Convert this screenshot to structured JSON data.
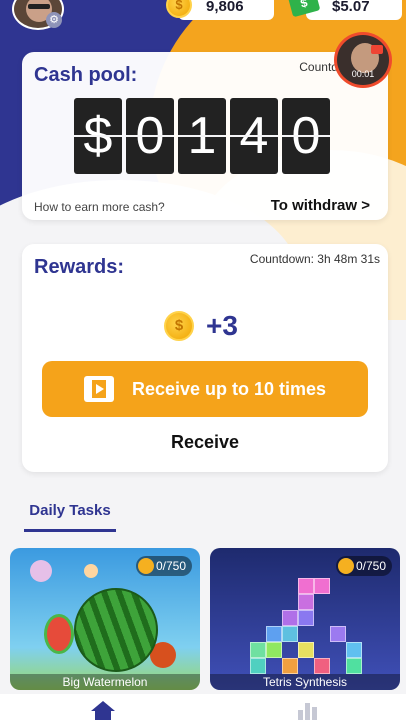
{
  "header": {
    "coins": "9,806",
    "cash": "$5.07",
    "coin_symbol": "$",
    "bill_symbol": "$"
  },
  "video": {
    "time": "00:01"
  },
  "cash_pool": {
    "title": "Cash pool:",
    "countdown": "Countdown: 2h",
    "digits": [
      "$",
      "0",
      "1",
      "4",
      "0"
    ],
    "earn_link": "How to earn more cash?",
    "withdraw_link": "To withdraw >"
  },
  "rewards": {
    "title": "Rewards:",
    "countdown": "Countdown: 3h 48m 31s",
    "amount": "+3",
    "coin_symbol": "$",
    "button_label": "Receive up to 10 times",
    "receive_label": "Receive"
  },
  "tabs": {
    "daily": "Daily Tasks"
  },
  "tasks": [
    {
      "name": "Big Watermelon",
      "progress": "0/750"
    },
    {
      "name": "Tetris Synthesis",
      "progress": "0/750"
    }
  ],
  "colors": {
    "primary": "#2f3591",
    "accent": "#f5a31a"
  },
  "icons": [
    "gear-icon",
    "coin-icon",
    "cash-icon",
    "film-icon",
    "home-icon",
    "chart-icon"
  ]
}
